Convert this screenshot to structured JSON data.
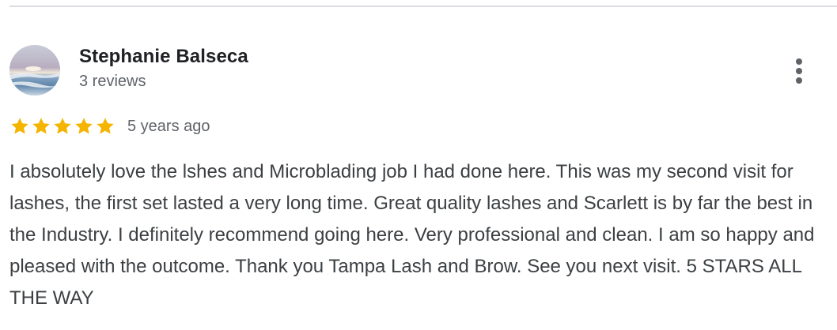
{
  "review": {
    "reviewer_name": "Stephanie Balseca",
    "reviewer_meta": "3 reviews",
    "rating": 5,
    "rating_max": 5,
    "timestamp": "5 years ago",
    "text": "I absolutely love the lshes and Microblading job I had done here. This was my second visit for lashes, the first set lasted a very long time. Great quality lashes and Scarlett is by far the best in the Industry. I definitely recommend going here. Very professional and clean. I am so happy and pleased with the outcome. Thank you Tampa Lash and Brow. See you next visit. 5 STARS ALL THE WAY"
  },
  "icons": {
    "more_menu": "more-vertical-icon",
    "star": "star-icon",
    "avatar": "beach-sunset-photo"
  },
  "colors": {
    "star": "#f4b400",
    "name": "#202124",
    "meta": "#5f6368",
    "body": "#3c4043",
    "divider": "#dadce0"
  }
}
